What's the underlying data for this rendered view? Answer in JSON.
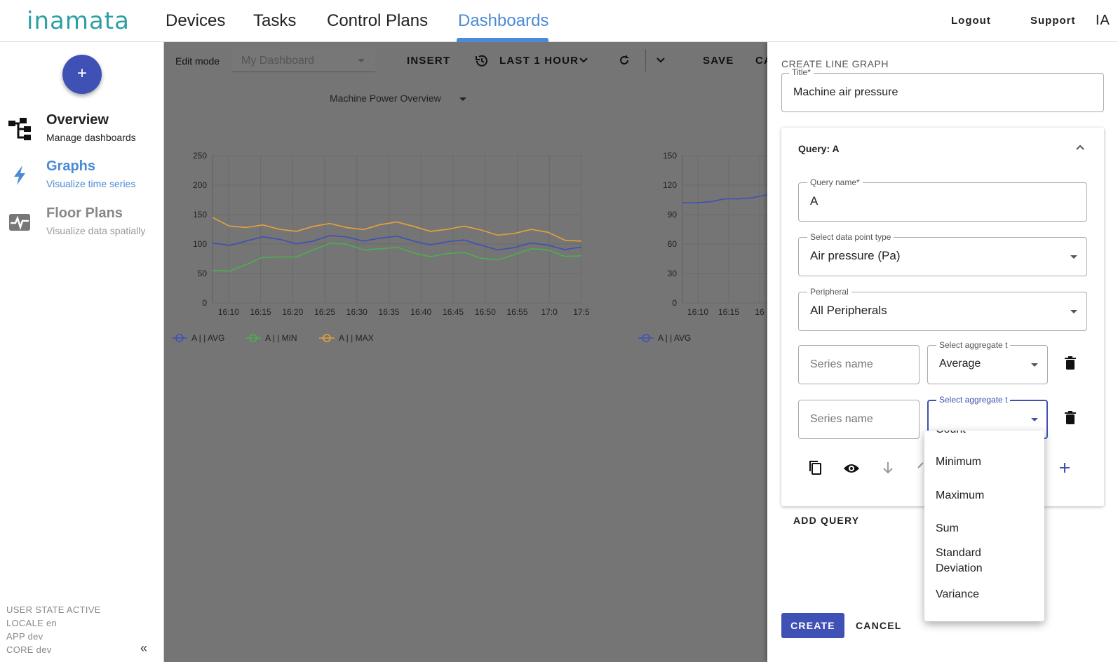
{
  "topbar": {
    "logo": "inamata",
    "nav": [
      "Devices",
      "Tasks",
      "Control Plans",
      "Dashboards"
    ],
    "logout": "Logout",
    "support": "Support",
    "user_initials": "IA"
  },
  "sidebar": {
    "add_label": "+",
    "items": [
      {
        "title": "Overview",
        "subtitle": "Manage dashboards"
      },
      {
        "title": "Graphs",
        "subtitle": "Visualize time series"
      },
      {
        "title": "Floor Plans",
        "subtitle": "Visualize data spatially"
      }
    ],
    "info": [
      "USER STATE ACTIVE",
      "LOCALE en",
      "APP dev",
      "CORE dev"
    ],
    "collapse": "«"
  },
  "toolbar": {
    "edit_mode": "Edit mode",
    "dashboard_placeholder": "My Dashboard",
    "insert": "INSERT",
    "time_range": "LAST 1 HOUR",
    "save": "SAVE",
    "cancel_cut": "CA"
  },
  "widget1": {
    "title": "Machine Power Overview",
    "y_ticks": [
      "250",
      "200",
      "150",
      "100",
      "50",
      "0"
    ],
    "x_ticks": [
      "16:10",
      "16:15",
      "16:20",
      "16:25",
      "16:30",
      "16:35",
      "16:40",
      "16:45",
      "16:50",
      "16:55",
      "17:0",
      "17:5"
    ],
    "legend": [
      "A |  | AVG",
      "A |  | MIN",
      "A |  | MAX"
    ],
    "colors": {
      "avg": "#3f51b5",
      "min": "#4caf50",
      "max": "#e6a23c"
    }
  },
  "widget2": {
    "y_ticks": [
      "150",
      "120",
      "90",
      "60",
      "30",
      "0"
    ],
    "x_ticks": [
      "16:10",
      "16:15",
      "16"
    ],
    "legend": [
      "A |  | AVG"
    ]
  },
  "chart_data": [
    {
      "type": "line",
      "title": "Machine Power Overview",
      "x": [
        "16:10",
        "16:15",
        "16:20",
        "16:25",
        "16:30",
        "16:35",
        "16:40",
        "16:45",
        "16:50",
        "16:55",
        "17:0",
        "17:5"
      ],
      "ylim": [
        0,
        250
      ],
      "series": [
        {
          "name": "A |  | AVG",
          "values": [
            102,
            105,
            108,
            105,
            112,
            110,
            105,
            104,
            98,
            94,
            98,
            95
          ]
        },
        {
          "name": "A |  | MIN",
          "values": [
            55,
            65,
            78,
            90,
            100,
            92,
            85,
            84,
            76,
            82,
            90,
            80
          ]
        },
        {
          "name": "A |  | MAX",
          "values": [
            145,
            128,
            125,
            130,
            128,
            133,
            130,
            125,
            124,
            118,
            120,
            105
          ]
        }
      ]
    },
    {
      "type": "line",
      "x": [
        "16:10",
        "16:15",
        "16"
      ],
      "ylim": [
        0,
        150
      ],
      "series": [
        {
          "name": "A |  | AVG",
          "values": [
            102,
            106,
            110
          ]
        }
      ]
    }
  ],
  "panel": {
    "heading": "CREATE LINE GRAPH",
    "title_label": "Title*",
    "title_value": "Machine air pressure",
    "query_header": "Query: A",
    "query_name_label": "Query name*",
    "query_name_value": "A",
    "dpt_label": "Select data point type",
    "dpt_value": "Air pressure (Pa)",
    "peripheral_label": "Peripheral",
    "peripheral_value": "All Peripherals",
    "series_placeholder": "Series name",
    "agg_label": "Select aggregate t",
    "agg1_value": "Average",
    "add_query": "ADD QUERY",
    "create": "CREATE",
    "cancel": "CANCEL"
  },
  "dropdown": {
    "options": [
      "Count",
      "Minimum",
      "Maximum",
      "Sum",
      "Standard",
      "Deviation",
      "Variance"
    ]
  }
}
